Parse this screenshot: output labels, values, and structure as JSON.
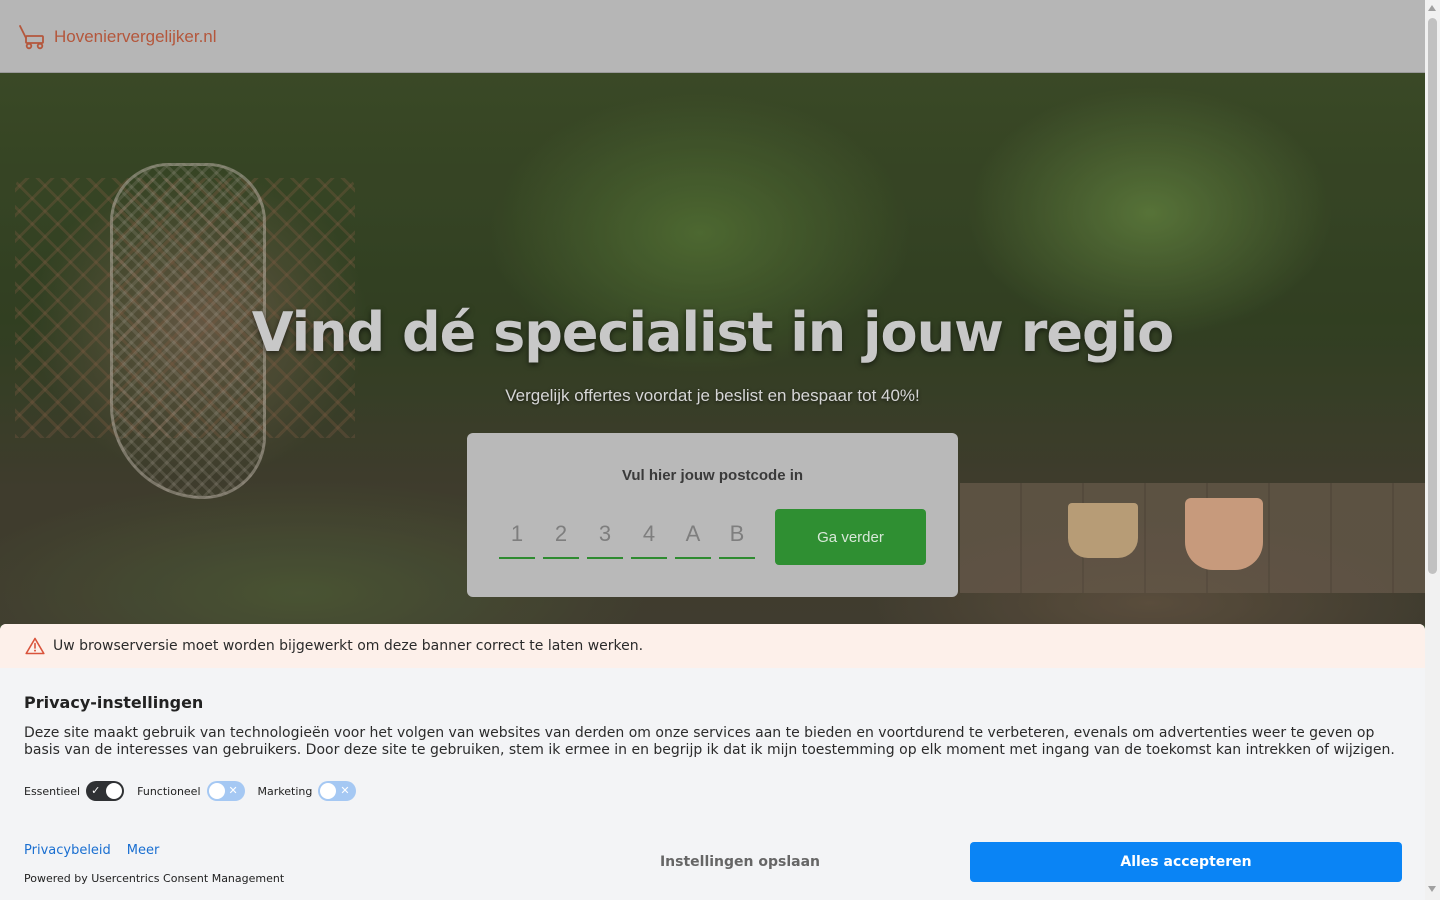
{
  "header": {
    "logo_text": "Hoveniervergelijker.nl",
    "logo_icon": "lawnmower-icon"
  },
  "hero": {
    "title": "Vind dé specialist in jouw regio",
    "subtitle": "Vergelijk offertes voordat je beslist en bespaar tot 40%!",
    "card_label": "Vul hier jouw postcode in",
    "postcode_placeholders": [
      "1",
      "2",
      "3",
      "4",
      "A",
      "B"
    ],
    "submit_label": "Ga verder"
  },
  "consent": {
    "warning": "Uw browserversie moet worden bijgewerkt om deze banner correct te laten werken.",
    "title": "Privacy-instellingen",
    "description": "Deze site maakt gebruik van technologieën voor het volgen van websites van derden om onze services aan te bieden en voortdurend te verbeteren, evenals om advertenties weer te geven op basis van de interesses van gebruikers. Door deze site te gebruiken, stem ik ermee in en begrijp ik dat ik mijn toestemming op elk moment met ingang van de toekomst kan intrekken of wijzigen.",
    "toggles": [
      {
        "label": "Essentieel",
        "state": "on"
      },
      {
        "label": "Functioneel",
        "state": "off"
      },
      {
        "label": "Marketing",
        "state": "off"
      }
    ],
    "links": {
      "privacy": "Privacybeleid",
      "more": "Meer"
    },
    "powered_by": "Powered by Usercentrics Consent Management",
    "save_label": "Instellingen opslaan",
    "accept_label": "Alles accepteren"
  },
  "colors": {
    "brand": "#b4573c",
    "primary_green": "#2f8f32",
    "accept_blue": "#0a84f5"
  }
}
